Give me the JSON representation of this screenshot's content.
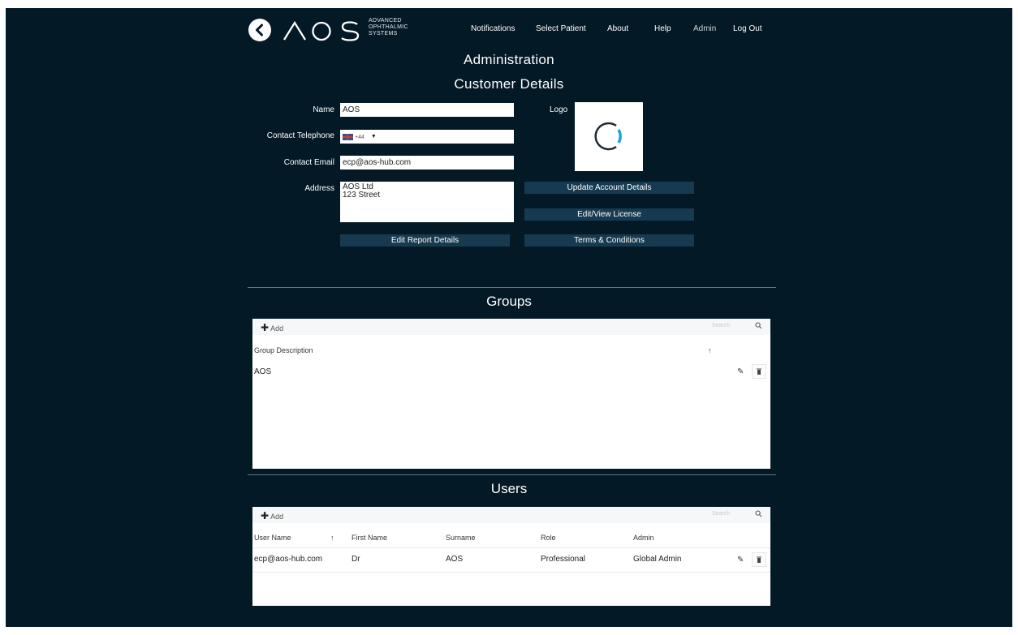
{
  "header": {
    "brand": "AOS",
    "brand_tagline": [
      "ADVANCED",
      "OPHTHALMIC",
      "SYSTEMS"
    ],
    "nav": [
      "Notifications",
      "Select Patient",
      "About",
      "Help",
      "Admin",
      "Log Out"
    ]
  },
  "page_title": "Administration",
  "customer": {
    "title": "Customer Details",
    "name_label": "Name",
    "name_value": "AOS",
    "phone_label": "Contact Telephone",
    "phone_code": "+44",
    "email_label": "Contact Email",
    "email_value": "ecp@aos-hub.com",
    "address_label": "Address",
    "address_value": "AOS Ltd\n123 Street",
    "logo_label": "Logo",
    "buttons": {
      "update_account": "Update Account Details",
      "edit_license": "Edit/View License",
      "terms": "Terms & Conditions",
      "edit_report": "Edit Report Details"
    }
  },
  "groups": {
    "title": "Groups",
    "add_label": "Add",
    "search_placeholder": "Search",
    "columns": [
      "Group Description"
    ],
    "sort_indicator": "↑",
    "rows": [
      [
        "AOS"
      ]
    ]
  },
  "users": {
    "title": "Users",
    "add_label": "Add",
    "search_placeholder": "Search",
    "columns": [
      "User Name",
      "First Name",
      "Surname",
      "Role",
      "Admin"
    ],
    "sort_indicator": "↑",
    "rows": [
      [
        "ecp@aos-hub.com",
        "Dr",
        "AOS",
        "Professional",
        "Global Admin"
      ]
    ]
  },
  "colors": {
    "background": "#041926",
    "button": "#163a4f",
    "accent_cyan": "#1aa7d6"
  }
}
